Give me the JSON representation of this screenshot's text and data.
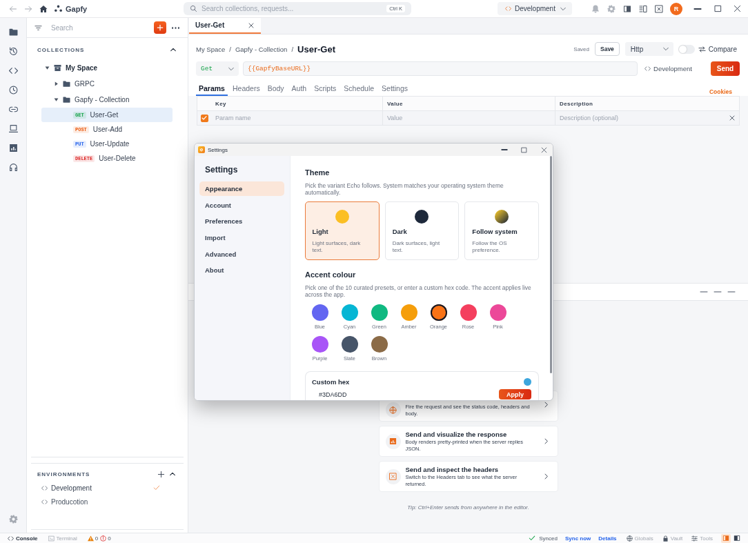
{
  "topbar": {
    "app_name": "Gapfy",
    "search": {
      "placeholder": "Search collections, requests...",
      "shortcut": "Ctrl K"
    },
    "environment": "Development",
    "avatar": "R"
  },
  "sidebar": {
    "search": {
      "placeholder": "Search"
    },
    "collections": {
      "title": "COLLECTIONS",
      "expanded": true,
      "tree": [
        {
          "label": "My Space",
          "kind": "workspace",
          "expanded": true,
          "selected": false,
          "children": [
            {
              "label": "GRPC",
              "kind": "folder",
              "expanded": false,
              "selected": false
            },
            {
              "label": "Gapfy - Collection",
              "kind": "folder",
              "expanded": true,
              "selected": false,
              "children": [
                {
                  "label": "User-Get",
                  "kind": "request",
                  "method": "GET",
                  "color": "#16a34a",
                  "selected": true
                },
                {
                  "label": "User-Add",
                  "kind": "request",
                  "method": "POST",
                  "color": "#ea580c",
                  "selected": false
                },
                {
                  "label": "User-Update",
                  "kind": "request",
                  "method": "PUT",
                  "color": "#2563eb",
                  "selected": false
                },
                {
                  "label": "User-Delete",
                  "kind": "request",
                  "method": "DELETE",
                  "color": "#dc2626",
                  "selected": false
                }
              ]
            }
          ]
        }
      ]
    },
    "environments": {
      "title": "ENVIRONMENTS",
      "expanded": true,
      "items": [
        {
          "name": "Development",
          "selected": true
        },
        {
          "name": "Producotion",
          "selected": false
        }
      ]
    }
  },
  "tabs": [
    {
      "label": "User-Get",
      "selected": true
    }
  ],
  "request": {
    "breadcrumb": {
      "items": [
        "My Space",
        "Gapfy - Collection",
        "User-Get"
      ],
      "separator": "/"
    },
    "save_status": "Saved",
    "save_label": "Save",
    "protocol": "Http",
    "compare": {
      "label": "Compare",
      "on": false
    },
    "method": "Get",
    "url": "{{GapfyBaseURL}}",
    "environment": "Development",
    "send_label": "Send",
    "tabs": [
      {
        "label": "Params",
        "selected": true
      },
      {
        "label": "Headers",
        "selected": false
      },
      {
        "label": "Body",
        "selected": false
      },
      {
        "label": "Auth",
        "selected": false
      },
      {
        "label": "Scripts",
        "selected": false
      },
      {
        "label": "Schedule",
        "selected": false
      },
      {
        "label": "Settings",
        "selected": false
      }
    ],
    "cookies": "Cookies",
    "params": {
      "columns": [
        "Key",
        "Value",
        "Description"
      ],
      "rows": [
        {
          "checked": true,
          "key": {
            "placeholder": "Param name"
          },
          "value": {
            "placeholder": "Value"
          },
          "description": {
            "placeholder": "Description (optional)"
          }
        }
      ]
    }
  },
  "response": {
    "hints": [
      {
        "description": "Fire the request and see the status code, headers and body."
      },
      {
        "title": "Send and visualize the response",
        "description": "Body renders pretty-printed when the server replies JSON."
      },
      {
        "title": "Send and inspect the headers",
        "description": "Switch to the Headers tab to see what the server returned."
      }
    ],
    "tip": "Tip: Ctrl+Enter sends from anywhere in the editor."
  },
  "settings_dialog": {
    "window_title": "Settings",
    "nav_title": "Settings",
    "nav": [
      {
        "label": "Appearance",
        "selected": true
      },
      {
        "label": "Account",
        "selected": false
      },
      {
        "label": "Preferences",
        "selected": false
      },
      {
        "label": "Import",
        "selected": false
      },
      {
        "label": "Advanced",
        "selected": false
      },
      {
        "label": "About",
        "selected": false
      }
    ],
    "theme": {
      "title": "Theme",
      "description": "Pick the variant Echo follows. System matches your operating system theme automatically.",
      "options": [
        {
          "kind": "light",
          "name": "Light",
          "description": "Light surfaces, dark text.",
          "selected": true
        },
        {
          "kind": "dark",
          "name": "Dark",
          "description": "Dark surfaces, light text.",
          "selected": false
        },
        {
          "kind": "system",
          "name": "Follow system",
          "description": "Follow the OS preference.",
          "selected": false
        }
      ]
    },
    "accent": {
      "title": "Accent colour",
      "description": "Pick one of the 10 curated presets, or enter a custom hex code. The accent applies live across the app.",
      "presets": [
        {
          "name": "Blue",
          "color": "#6366f1",
          "selected": false
        },
        {
          "name": "Cyan",
          "color": "#06b6d4",
          "selected": false
        },
        {
          "name": "Green",
          "color": "#10b981",
          "selected": false
        },
        {
          "name": "Amber",
          "color": "#f59e0b",
          "selected": false
        },
        {
          "name": "Orange",
          "color": "#f97316",
          "selected": true
        },
        {
          "name": "Rose",
          "color": "#f43f5e",
          "selected": false
        },
        {
          "name": "Pink",
          "color": "#ec4899",
          "selected": false
        },
        {
          "name": "Purple",
          "color": "#a855f7",
          "selected": false
        },
        {
          "name": "Slate",
          "color": "#475569",
          "selected": false
        },
        {
          "name": "Brown",
          "color": "#8b6b47",
          "selected": false
        }
      ]
    },
    "custom_hex": {
      "title": "Custom hex",
      "color": "#3da6dd",
      "value": "#3DA6DD",
      "apply_label": "Apply"
    }
  },
  "status_bar": {
    "panels": [
      {
        "label": "Console",
        "selected": true
      },
      {
        "label": "Terminal",
        "selected": false
      }
    ],
    "warnings": "0",
    "errors": "0",
    "sync_status": "Synced",
    "sync_action": "Sync now",
    "details": "Details",
    "tools": [
      {
        "label": "Globals"
      },
      {
        "label": "Vault"
      },
      {
        "label": "Tools"
      }
    ],
    "layout_toggles": [
      {
        "selected": true
      },
      {
        "selected": false
      }
    ]
  }
}
